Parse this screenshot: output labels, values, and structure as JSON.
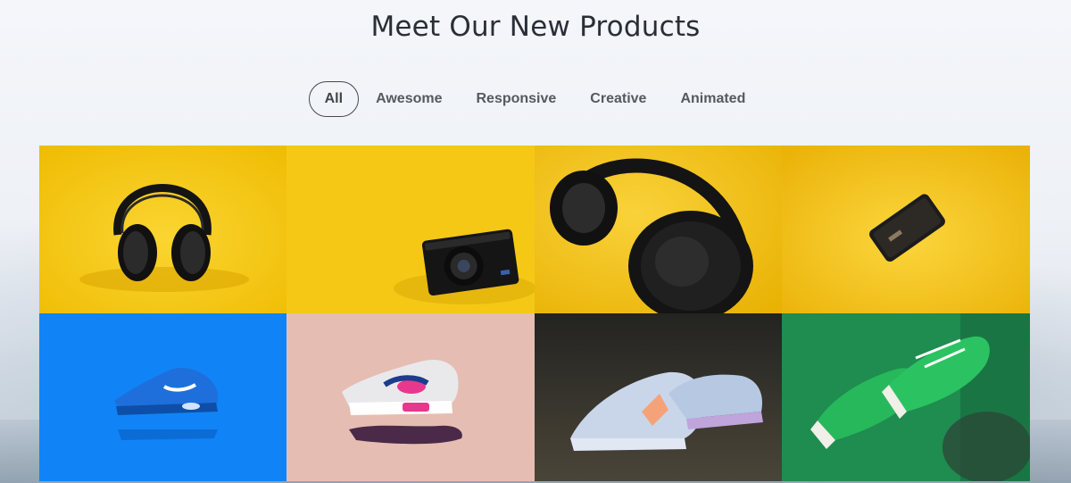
{
  "section": {
    "title": "Meet Our New Products"
  },
  "filters": [
    {
      "label": "All",
      "active": true
    },
    {
      "label": "Awesome",
      "active": false
    },
    {
      "label": "Responsive",
      "active": false
    },
    {
      "label": "Creative",
      "active": false
    },
    {
      "label": "Animated",
      "active": false
    }
  ],
  "products": [
    {
      "name": "headphones-front",
      "background": "#f6c90e"
    },
    {
      "name": "compact-camera",
      "background": "#f5c815"
    },
    {
      "name": "headphones-side",
      "background": "#f3c210"
    },
    {
      "name": "smartphone",
      "background": "#f4bf12"
    },
    {
      "name": "blue-sneaker",
      "background": "#1084f6"
    },
    {
      "name": "pink-white-sneaker",
      "background": "#e6bdb2"
    },
    {
      "name": "light-blue-sneakers",
      "background": "#2a2a28"
    },
    {
      "name": "green-sneakers",
      "background": "#1f8c50"
    }
  ],
  "colors": {
    "title": "#2a2f36",
    "filter_text": "#555a60",
    "active_border": "#45494e"
  }
}
